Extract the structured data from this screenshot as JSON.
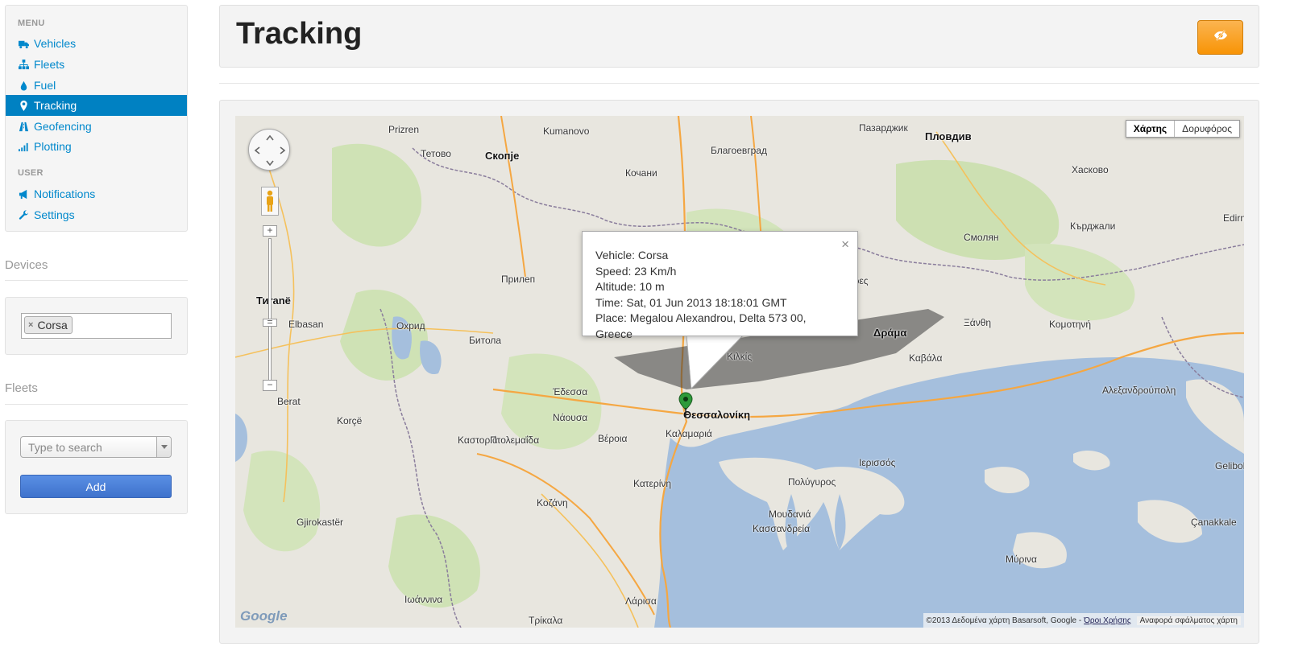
{
  "sidebar": {
    "menu_header": "MENU",
    "user_header": "USER",
    "items": [
      {
        "label": "Vehicles",
        "icon": "truck-icon"
      },
      {
        "label": "Fleets",
        "icon": "sitemap-icon"
      },
      {
        "label": "Fuel",
        "icon": "drop-icon"
      },
      {
        "label": "Tracking",
        "icon": "map-marker-icon"
      },
      {
        "label": "Geofencing",
        "icon": "road-icon"
      },
      {
        "label": "Plotting",
        "icon": "signal-icon"
      }
    ],
    "user_items": [
      {
        "label": "Notifications",
        "icon": "bullhorn-icon"
      },
      {
        "label": "Settings",
        "icon": "wrench-icon"
      }
    ]
  },
  "devices": {
    "title": "Devices",
    "selected": [
      "Corsa"
    ]
  },
  "fleets": {
    "title": "Fleets",
    "placeholder": "Type to search",
    "add_label": "Add"
  },
  "header": {
    "title": "Tracking",
    "eye_icon": "eye-slash-icon"
  },
  "map": {
    "type_buttons": [
      "Χάρτης",
      "Δορυφόρος"
    ],
    "info": {
      "vehicle": "Vehicle: Corsa",
      "speed": "Speed: 23 Km/h",
      "altitude": "Altitude: 10 m",
      "time": "Time: Sat, 01 Jun 2013 18:18:01 GMT",
      "place": "Place: Megalou Alexandrou, Delta 573 00, Greece"
    },
    "footer_text": "©2013 Δεδομένα χάρτη Basarsoft, Google -",
    "footer_terms": "Όροι Χρήσης",
    "footer_report": "Αναφορά σφάλματος χάρτη",
    "logo": "Google",
    "labels": [
      "Пловдив",
      "Скопје",
      "Prizren",
      "Kumanovo",
      "Тетово",
      "Кочани",
      "Благоевград",
      "Пазарджик",
      "Хасково",
      "Кърджали",
      "Смолян",
      "Тиranë",
      "Elbasan",
      "Охрид",
      "Битола",
      "Прилеп",
      "Δράμα",
      "Ξάνθη",
      "Κομοτηνή",
      "Καβάλα",
      "Θεσσαλονίκη",
      "Καλαμαριά",
      "Έδεσσα",
      "Νάουσα",
      "Βέροια",
      "Κατερίνη",
      "Κοζάνη",
      "Καστοριά",
      "Πτολεμαΐδα",
      "Λάρισα",
      "Τρίκαλα",
      "Ιωάννινα",
      "Μουδανιά",
      "Κασσανδρεία",
      "Αλεξανδρούπολη",
      "Berat",
      "Korçë",
      "Gjirokastër",
      "Edirne",
      "Çanakkale",
      "Gelibolu",
      "Σέρρες",
      "Πολύγυρος",
      "Ιερισσός",
      "Μύρινα",
      "Κιλκίς"
    ]
  },
  "colors": {
    "accent": "#0081c2",
    "link": "#0088cc",
    "warning": "#f89406",
    "sea": "#a5bfdd",
    "land": "#e8e6df",
    "forest": "#c9dfae"
  }
}
